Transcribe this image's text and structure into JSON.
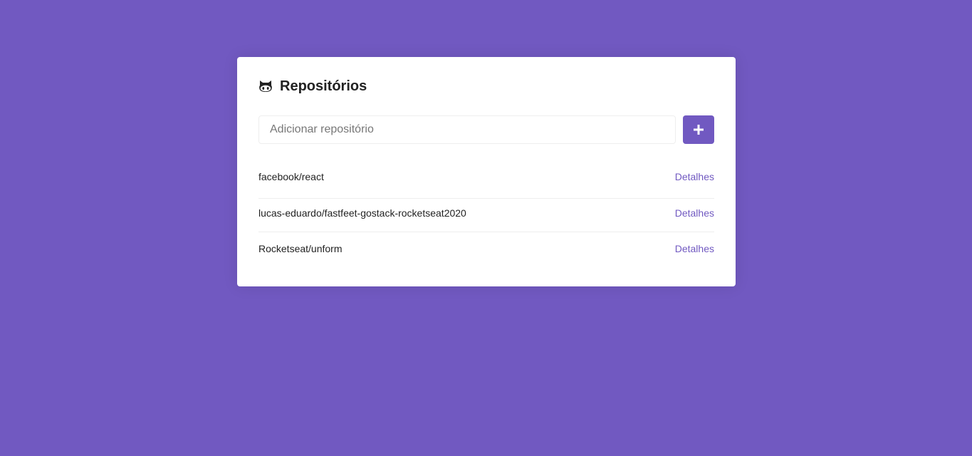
{
  "header": {
    "title": "Repositórios",
    "icon": "github-icon"
  },
  "form": {
    "input_placeholder": "Adicionar repositório",
    "input_value": "",
    "submit_icon": "plus-icon"
  },
  "repositories": [
    {
      "name": "facebook/react",
      "link_label": "Detalhes"
    },
    {
      "name": "lucas-eduardo/fastfeet-gostack-rocketseat2020",
      "link_label": "Detalhes"
    },
    {
      "name": "Rocketseat/unform",
      "link_label": "Detalhes"
    }
  ],
  "colors": {
    "background": "#7159c1",
    "accent": "#7159c1",
    "card": "#ffffff"
  }
}
